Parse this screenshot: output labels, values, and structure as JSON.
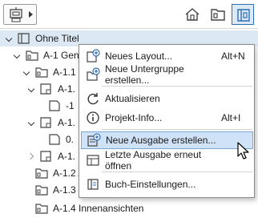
{
  "tree": {
    "root": {
      "label": "Ohne Titel"
    },
    "rows": [
      {
        "label": "A-1 Gen"
      },
      {
        "label": "A-1.1 G"
      },
      {
        "label": "A-1."
      },
      {
        "label": "-1"
      },
      {
        "label": "A-1."
      },
      {
        "label": "0."
      },
      {
        "label": "A-1."
      },
      {
        "label": "A-1.2 A"
      },
      {
        "label": "A-1.3 Schnitte"
      },
      {
        "label": "A-1.4 Innenansichten"
      }
    ]
  },
  "context_menu": {
    "items": [
      {
        "label": "Neues Layout...",
        "shortcut": "Alt+N",
        "icon": "new-layout-icon"
      },
      {
        "label": "Neue Untergruppe erstellen...",
        "shortcut": "",
        "icon": "new-subset-icon"
      },
      {
        "label": "Aktualisieren",
        "shortcut": "",
        "icon": "refresh-icon"
      },
      {
        "label": "Projekt-Info...",
        "shortcut": "Alt+I",
        "icon": "info-icon"
      },
      {
        "label": "Neue Ausgabe erstellen...",
        "shortcut": "",
        "icon": "new-issue-icon"
      },
      {
        "label": "Letzte Ausgabe erneut öffnen",
        "shortcut": "",
        "icon": "reopen-issue-icon"
      },
      {
        "label": "Buch-Einstellungen...",
        "shortcut": "",
        "icon": "book-settings-icon"
      }
    ],
    "highlighted_item": "Neue Ausgabe erstellen..."
  },
  "colors": {
    "accent": "#2f6fb3",
    "highlight": "#cfe2f7",
    "selection": "#dde8f5"
  }
}
